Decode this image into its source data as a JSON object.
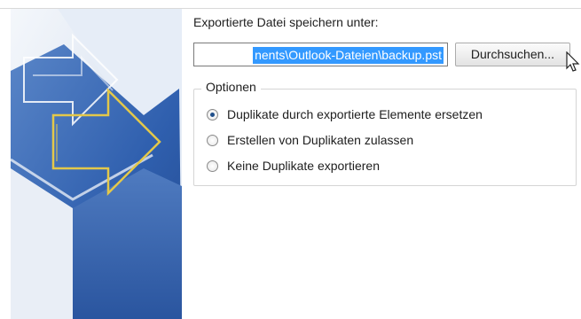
{
  "export": {
    "save_label": "Exportierte Datei speichern unter:",
    "path_value": "nents\\Outlook-Dateien\\backup.pst",
    "browse_label": "Durchsuchen..."
  },
  "options": {
    "legend": "Optionen",
    "items": [
      {
        "label": "Duplikate durch exportierte Elemente ersetzen",
        "checked": true
      },
      {
        "label": "Erstellen von Duplikaten zulassen",
        "checked": false
      },
      {
        "label": "Keine Duplikate exportieren",
        "checked": false
      }
    ]
  },
  "icons": {
    "wizard_graphic": "export-arrow-graphic",
    "cursor": "mouse-pointer-icon"
  },
  "colors": {
    "selection": "#3399ff",
    "graphic_blue": "#2f5fae",
    "graphic_arrow": "#e3c84a"
  }
}
